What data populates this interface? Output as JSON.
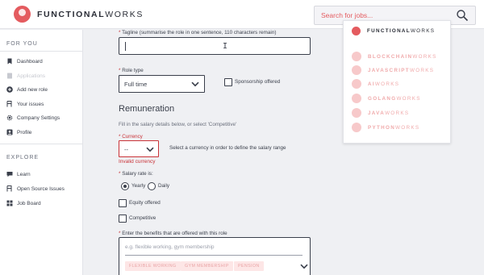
{
  "brand": {
    "bold": "FUNCTIONAL",
    "light": "WORKS",
    "accent": "#e45b5f"
  },
  "search": {
    "placeholder": "Search for jobs..."
  },
  "sidebar": {
    "sections": [
      {
        "title": "FOR YOU",
        "items": [
          {
            "label": "Dashboard",
            "icon": "bookmark-icon"
          },
          {
            "label": "Applications",
            "icon": "document-icon",
            "disabled": true
          },
          {
            "label": "Add new role",
            "icon": "plus-circle-icon"
          },
          {
            "label": "Your issues",
            "icon": "issue-icon"
          },
          {
            "label": "Company Settings",
            "icon": "gear-icon"
          },
          {
            "label": "Profile",
            "icon": "user-icon"
          }
        ]
      },
      {
        "title": "EXPLORE",
        "items": [
          {
            "label": "Learn",
            "icon": "chat-icon"
          },
          {
            "label": "Open Source Issues",
            "icon": "issue-icon"
          },
          {
            "label": "Job Board",
            "icon": "grid-icon"
          }
        ]
      }
    ]
  },
  "form": {
    "tagline": {
      "label": "Tagline (summarise the role in one sentence, 110 characters remain)",
      "value": ""
    },
    "role_type": {
      "label": "Role type",
      "value": "Full time"
    },
    "sponsorship": {
      "label": "Sponsorship offered",
      "checked": false
    },
    "remuneration": {
      "heading": "Remuneration",
      "hint": "Fill in the salary details below, or select 'Competitive'",
      "currency": {
        "label": "Currency",
        "value": "--",
        "help": "Select a currency in order to define the salary range",
        "error": "Invalid currency"
      },
      "salary_rate": {
        "label": "Salary rate is:",
        "options": [
          "Yearly",
          "Daily"
        ],
        "selected": "Yearly"
      },
      "equity": {
        "label": "Equity offered",
        "checked": false
      },
      "competitive": {
        "label": "Competitive",
        "checked": false
      }
    },
    "benefits": {
      "label": "Enter the benefits that are offered with this role",
      "placeholder": "e.g. flexible working, gym membership",
      "tags": [
        "FLEXIBLE WORKING",
        "GYM MEMBERSHIP",
        "PENSION"
      ]
    }
  },
  "preview_card": {
    "title": {
      "bold": "FUNCTIONAL",
      "light": "WORKS"
    },
    "items": [
      {
        "bold": "BLOCKCHAIN",
        "light": "WORKS"
      },
      {
        "bold": "JAVASCRIPT",
        "light": "WORKS"
      },
      {
        "bold": "AI",
        "light": "WORKS"
      },
      {
        "bold": "GOLANG",
        "light": "WORKS"
      },
      {
        "bold": "JAVA",
        "light": "WORKS"
      },
      {
        "bold": "PYTHON",
        "light": "WORKS"
      }
    ]
  }
}
